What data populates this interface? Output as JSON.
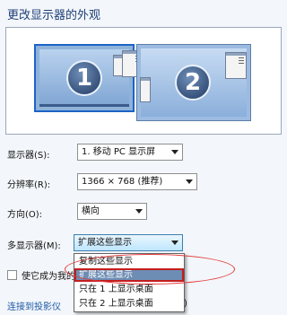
{
  "header": {
    "title": "更改显示器的外观"
  },
  "preview": {
    "monitor1_number": "1",
    "monitor2_number": "2"
  },
  "settings": {
    "display_label": "显示器(S):",
    "display_value": "1. 移动 PC 显示屏",
    "resolution_label": "分辨率(R):",
    "resolution_value": "1366 × 768 (推荐)",
    "orientation_label": "方向(O):",
    "orientation_value": "横向",
    "multi_label": "多显示器(M):",
    "multi_value": "扩展这些显示",
    "multi_options": [
      "复制这些显示",
      "扩展这些显示",
      "只在 1 上显示桌面",
      "只在 2 上显示桌面"
    ],
    "multi_selected_index": 1
  },
  "main_display": {
    "label": "使它成为我的"
  },
  "projector": {
    "link": "连接到投影仪",
    "link_tail": "P)"
  },
  "colors": {
    "selection": "#6d8db5",
    "annotation": "#d62a2a",
    "monitor_border": "#1d63c6"
  }
}
